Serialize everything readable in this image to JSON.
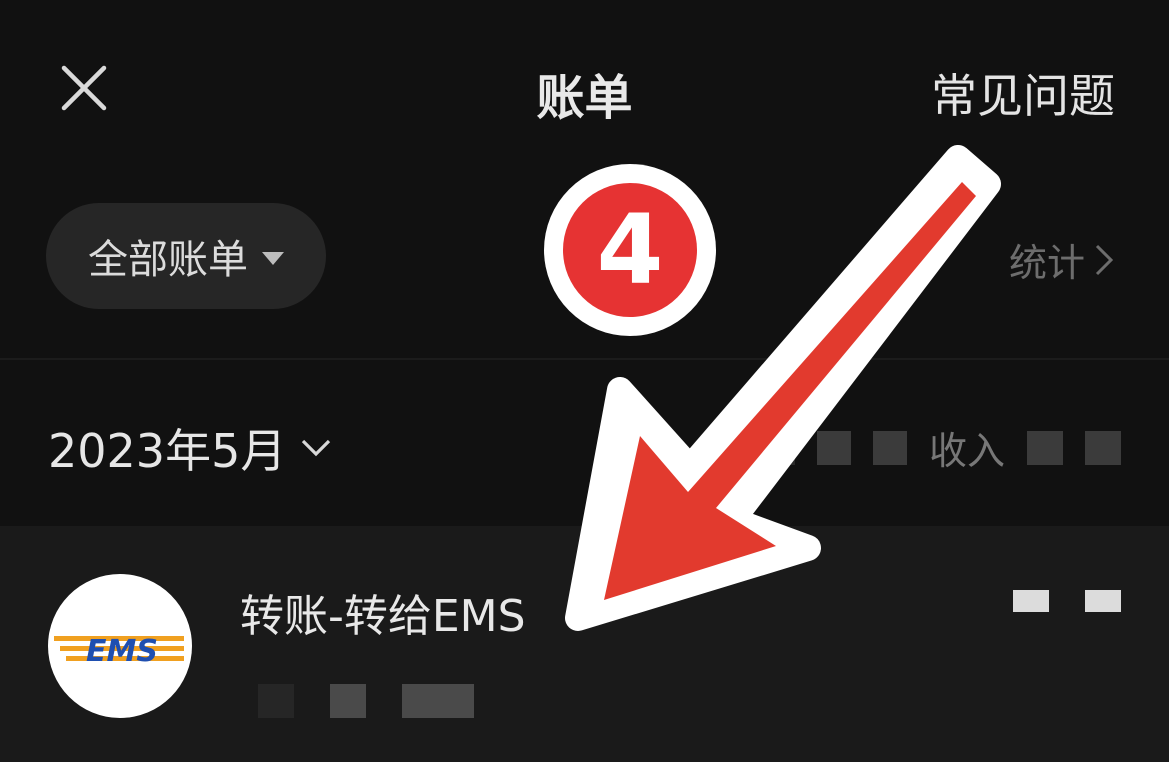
{
  "header": {
    "title": "账单",
    "faq_label": "常见问题",
    "close_icon": "close-icon"
  },
  "filter": {
    "label": "全部账单",
    "caret_icon": "caret-down-icon"
  },
  "stats_link": {
    "label": "统计",
    "icon": "chevron-right-icon"
  },
  "month_row": {
    "label": "2023年5月",
    "chevron_icon": "chevron-down-icon",
    "income_label": "收入"
  },
  "transaction": {
    "title": "转账-转给EMS",
    "avatar_text": "EMS",
    "avatar_icon": "ems-logo-icon"
  },
  "annotation": {
    "badge_number": "4",
    "badge_color": "#e63333",
    "arrow_color": "#e23a2e",
    "arrow_icon": "arrow-annotation-icon"
  }
}
